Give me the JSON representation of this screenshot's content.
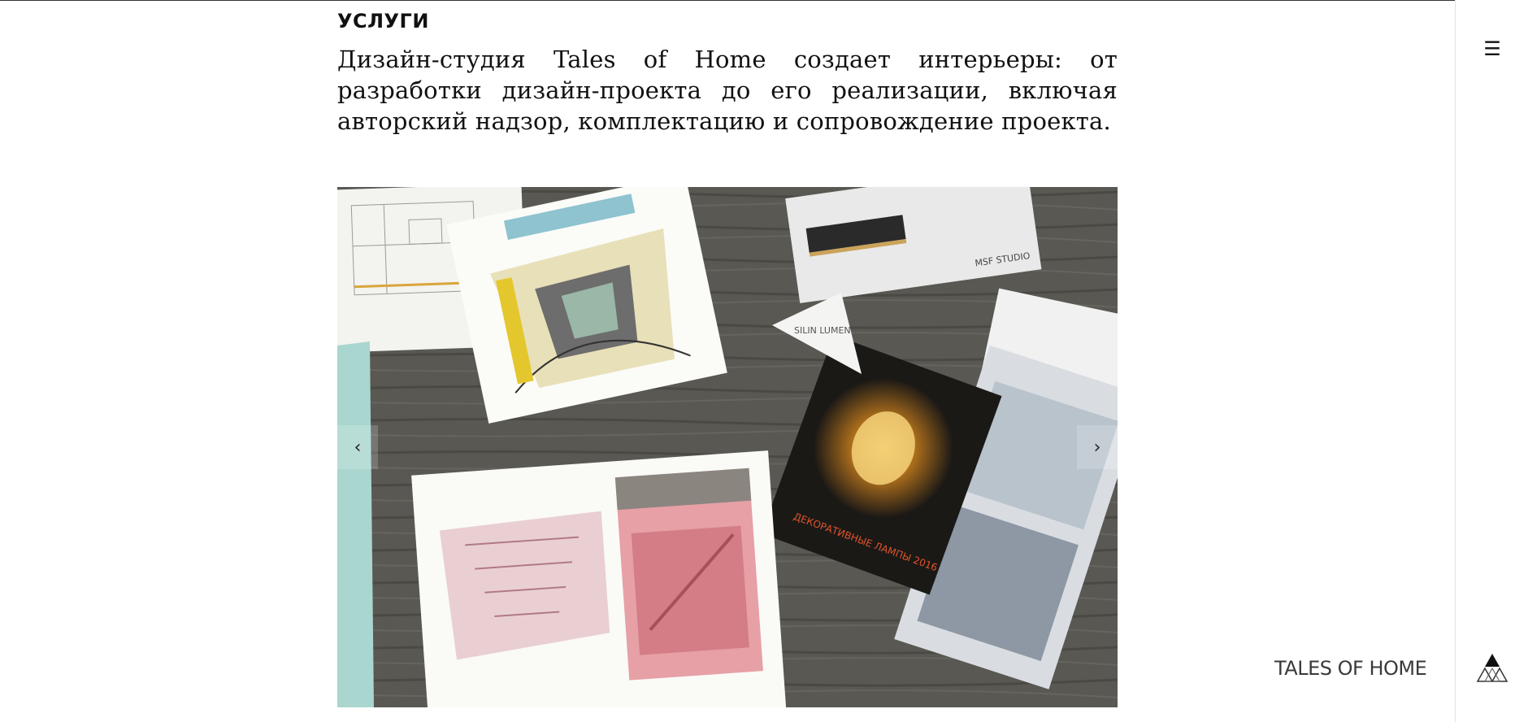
{
  "section": {
    "title": "УСЛУГИ",
    "intro": "Дизайн-студия Tales of Home создает интерьеры: от разработки дизайн-проекта до его реализации, включая авторский надзор, комплектацию и сопровождение проекта."
  },
  "slider": {
    "prev_glyph": "‹",
    "next_glyph": "›",
    "prev_icon": "chevron-left-icon",
    "next_icon": "chevron-right-icon",
    "photo_texts": {
      "card_brand": "SILIN LUMEN",
      "card_caption": "ДЕКОРАТИВНЫЕ ЛАМПЫ 2016",
      "catalog_label": "MSF STUDIO"
    }
  },
  "header": {
    "menu_glyph": "☰",
    "menu_icon": "hamburger-menu-icon"
  },
  "brand": {
    "name": "TALES OF HOME",
    "logo_icon": "triangle-logo-icon"
  },
  "colors": {
    "table_wood": "#585651",
    "text": "#111111",
    "brand_text": "#3a3a3a",
    "divider": "#e2e2e2"
  }
}
